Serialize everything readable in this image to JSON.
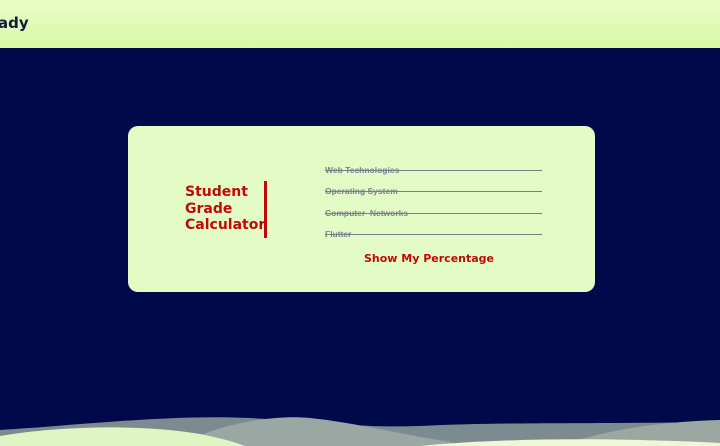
{
  "header": {
    "brand": "ady"
  },
  "calculator": {
    "title_lines": [
      "Student",
      "Grade",
      "Calculator"
    ],
    "fields": [
      {
        "placeholder": "Web Technologies"
      },
      {
        "placeholder": "Operating System"
      },
      {
        "placeholder": "Computer  Networks"
      },
      {
        "placeholder": "Flutter"
      }
    ],
    "submit_label": "Show My Percentage"
  },
  "colors": {
    "background": "#000a4a",
    "header": "#d7f9a6",
    "card": "#e3fbc4",
    "accent": "#c00a0a",
    "wave": "#8a9a96"
  }
}
